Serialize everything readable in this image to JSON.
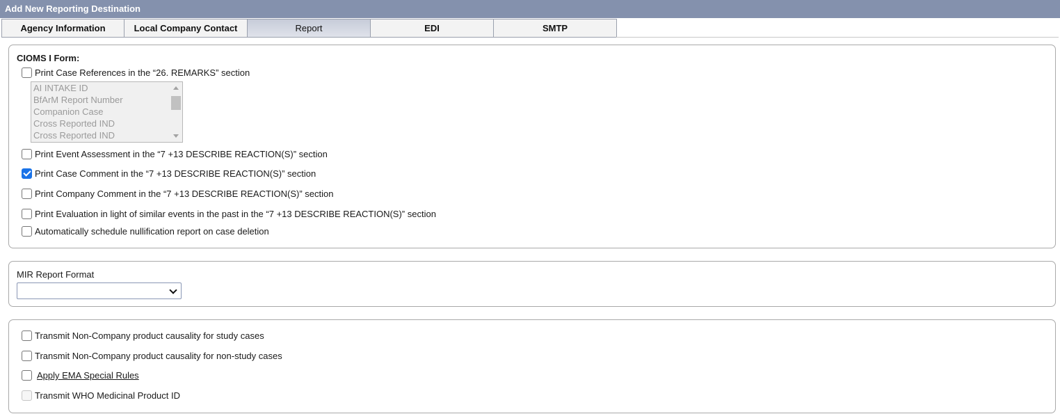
{
  "window": {
    "title": "Add New Reporting Destination"
  },
  "tabs": [
    {
      "label": "Agency Information",
      "active": false
    },
    {
      "label": "Local Company Contact",
      "active": false
    },
    {
      "label": "Report",
      "active": true
    },
    {
      "label": "EDI",
      "active": false
    },
    {
      "label": "SMTP",
      "active": false
    }
  ],
  "cioms": {
    "heading": "CIOMS I Form:",
    "print_case_refs": {
      "label": "Print Case References in the “26. REMARKS” section",
      "checked": false
    },
    "reference_list": {
      "items": [
        "AI INTAKE ID",
        "BfArM Report Number",
        "Companion Case",
        "Cross Reported IND",
        "Cross Reported IND"
      ],
      "disabled": true
    },
    "options": [
      {
        "label": "Print Event Assessment in the “7 +13 DESCRIBE REACTION(S)” section",
        "checked": false
      },
      {
        "label": "Print Case Comment in the “7 +13 DESCRIBE REACTION(S)” section",
        "checked": true
      },
      {
        "label": "Print Company Comment in the “7 +13 DESCRIBE REACTION(S)” section",
        "checked": false
      },
      {
        "label": "Print Evaluation in light of similar events in the past in the “7 +13 DESCRIBE REACTION(S)” section",
        "checked": false
      },
      {
        "label": "Automatically schedule nullification report on case deletion",
        "checked": false
      }
    ]
  },
  "mir": {
    "label": "MIR Report Format",
    "selected": ""
  },
  "transmit": {
    "options": [
      {
        "label": "Transmit Non-Company product causality for study cases",
        "checked": false,
        "disabled": false
      },
      {
        "label": "Transmit Non-Company product causality for non-study cases",
        "checked": false,
        "disabled": false
      },
      {
        "label": "Apply EMA Special Rules",
        "checked": false,
        "disabled": false
      },
      {
        "label": "Transmit WHO Medicinal Product ID",
        "checked": false,
        "disabled": true
      }
    ]
  },
  "colors": {
    "titlebar": "#8491ad",
    "checkbox_checked": "#1a73e8",
    "panel_border": "#a9a9a9"
  }
}
